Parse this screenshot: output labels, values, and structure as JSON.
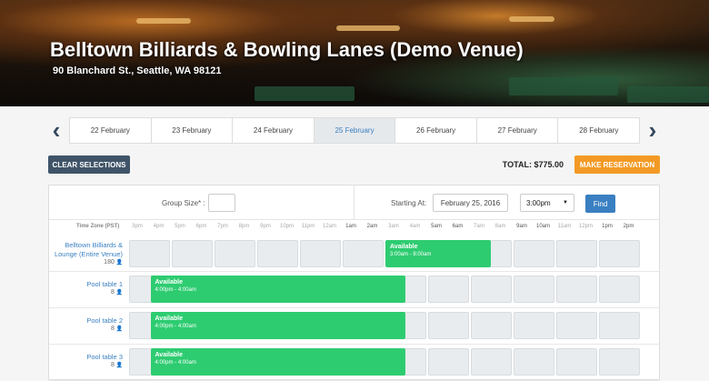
{
  "venue": {
    "name": "Belltown Billiards & Bowling Lanes (Demo Venue)",
    "address": "90 Blanchard St., Seattle, WA 98121"
  },
  "date_nav": {
    "prev_icon": "chevron-left-icon",
    "next_icon": "chevron-right-icon",
    "days": [
      "22 February",
      "23 February",
      "24 February",
      "25 February",
      "26 February",
      "27 February",
      "28 February"
    ],
    "active_index": 3
  },
  "toolbar": {
    "clear_label": "CLEAR SELECTIONS",
    "total_text": "TOTAL: $775.00",
    "reserve_label": "MAKE RESERVATION"
  },
  "filters": {
    "group_size_label": "Group Size* :",
    "group_size_value": "",
    "starting_at_label": "Starting At:",
    "date_value": "February 25, 2016",
    "time_value": "3:00pm",
    "find_label": "Find"
  },
  "timeline": {
    "tz_label": "Time Zone (PST)",
    "hours": [
      "3pm",
      "4pm",
      "5pm",
      "6pm",
      "7pm",
      "8pm",
      "9pm",
      "10pm",
      "11pm",
      "12am",
      "1am",
      "2am",
      "3am",
      "4am",
      "5am",
      "6am",
      "7am",
      "8am",
      "9am",
      "10am",
      "11am",
      "12pm",
      "1pm",
      "2pm"
    ]
  },
  "resources": [
    {
      "name": "Belltown Billiards & Lounge (Entire Venue)",
      "capacity": "180",
      "avail_title": "Available",
      "avail_time": "3:00am - 8:00am"
    },
    {
      "name": "Pool table 1",
      "capacity": "8",
      "avail_title": "Available",
      "avail_time": "4:00pm - 4:00am"
    },
    {
      "name": "Pool table 2",
      "capacity": "8",
      "avail_title": "Available",
      "avail_time": "4:00pm - 4:00am"
    },
    {
      "name": "Pool table 3",
      "capacity": "8",
      "avail_title": "Available",
      "avail_time": "4:00pm - 4:00am"
    }
  ]
}
